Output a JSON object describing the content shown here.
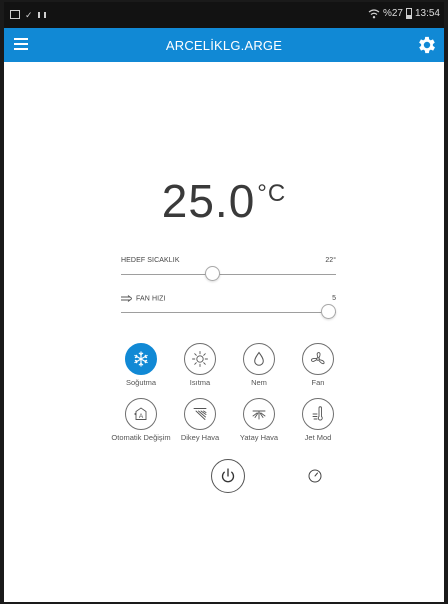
{
  "status_bar": {
    "battery_text": "%27",
    "time": "13:54"
  },
  "app_bar": {
    "title": "ARCELİKLG.ARGE",
    "menu_icon": "menu-icon",
    "settings_icon": "gear-icon"
  },
  "temperature": {
    "value": "25.0",
    "unit": "°C"
  },
  "target_slider": {
    "label": "HEDEF SICAKLIK",
    "value": "22°",
    "level_fraction": 0.42
  },
  "fan_slider": {
    "label": "FAN HIZI",
    "value": "5",
    "level_fraction": 1.0,
    "icon": "fan-speed-icon"
  },
  "modes": [
    {
      "label": "Soğutma",
      "icon": "snowflake-icon",
      "active": true
    },
    {
      "label": "Isıtma",
      "icon": "sun-icon",
      "active": false
    },
    {
      "label": "Nem",
      "icon": "droplet-icon",
      "active": false
    },
    {
      "label": "Fan",
      "icon": "fan-icon",
      "active": false
    },
    {
      "label": "Otomatik Değişim",
      "icon": "auto-mode-icon",
      "active": false
    },
    {
      "label": "Dikey Hava",
      "icon": "vertical-airflow-icon",
      "active": false
    },
    {
      "label": "Yatay Hava",
      "icon": "horizontal-airflow-icon",
      "active": false
    },
    {
      "label": "Jet Mod",
      "icon": "jet-mode-icon",
      "active": false
    }
  ],
  "controls": {
    "power_icon": "power-icon",
    "timer_icon": "timer-icon"
  },
  "colors": {
    "accent": "#1189d5",
    "status_bar": "#121212"
  }
}
